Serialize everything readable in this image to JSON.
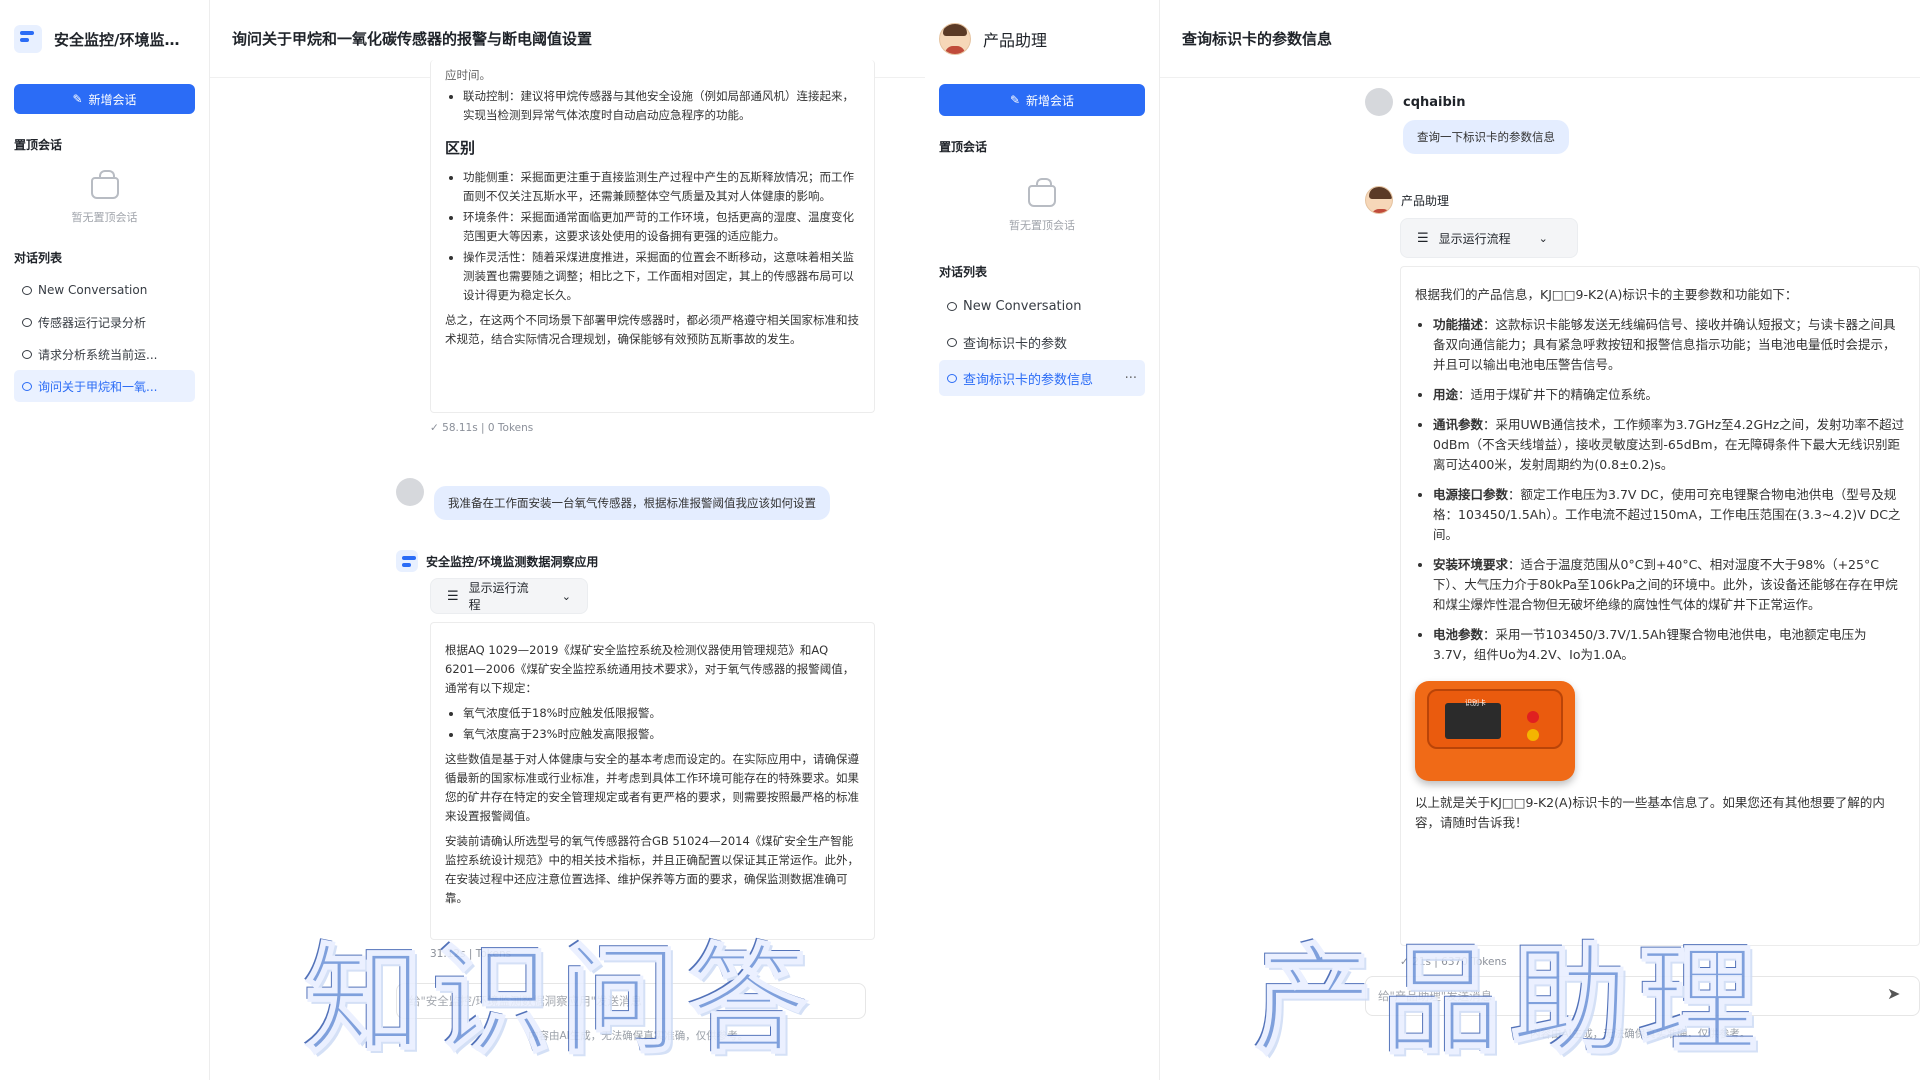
{
  "left_app": {
    "brand_title": "安全监控/环境监测...",
    "new_chat_label": "新增会话",
    "pinned_label": "置顶会话",
    "pinned_empty": "暂无置顶会话",
    "list_label": "对话列表",
    "conversations": [
      "New Conversation",
      "传感器运行记录分析",
      "请求分析系统当前运...",
      "询问关于甲烷和一氧..."
    ],
    "title": "询问关于甲烷和一氧化碳传感器的报警与断电阈值设置",
    "msg1_top_fragment": "应时间。",
    "msg1_link_item": "联动控制：建议将甲烷传感器与其他安全设施（例如局部通风机）连接起来，实现当检测到异常气体浓度时自动启动应急程序的功能。",
    "msg1_heading": "区别",
    "msg1_items": [
      "功能侧重：采掘面更注重于直接监测生产过程中产生的瓦斯释放情况；而工作面则不仅关注瓦斯水平，还需兼顾整体空气质量及其对人体健康的影响。",
      "环境条件：采掘面通常面临更加严苛的工作环境，包括更高的湿度、温度变化范围更大等因素，这要求该处使用的设备拥有更强的适应能力。",
      "操作灵活性：随着采煤进度推进，采掘面的位置会不断移动，这意味着相关监测装置也需要随之调整；相比之下，工作面相对固定，其上的传感器布局可以设计得更为稳定长久。"
    ],
    "msg1_summary": "总之，在这两个不同场景下部署甲烷传感器时，都必须严格遵守相关国家标准和技术规范，结合实际情况合理规划，确保能够有效预防瓦斯事故的发生。",
    "msg1_meta": "✓ 58.11s  |  0 Tokens",
    "user_msg": "我准备在工作面安装一台氧气传感器，根据标准报警阈值我应该如何设置",
    "bot_name": "安全监控/环境监测数据洞察应用",
    "flow_label": "显示运行流程",
    "msg2_intro": "根据AQ 1029—2019《煤矿安全监控系统及检测仪器使用管理规范》和AQ 6201—2006《煤矿安全监控系统通用技术要求》，对于氧气传感器的报警阈值，通常有以下规定：",
    "msg2_items": [
      "氧气浓度低于18%时应触发低限报警。",
      "氧气浓度高于23%时应触发高限报警。"
    ],
    "msg2_p1": "这些数值是基于对人体健康与安全的基本考虑而设定的。在实际应用中，请确保遵循最新的国家标准或行业标准，并考虑到具体工作环境可能存在的特殊要求。如果您的矿井存在特定的安全管理规定或者有更严格的要求，则需要按照最严格的标准来设置报警阈值。",
    "msg2_p2": "安装前请确认所选型号的氧气传感器符合GB 51024—2014《煤矿安全生产智能监控系统设计规范》中的相关技术指标，并且正确配置以保证其正常运作。此外，在安装过程中还应注意位置选择、维护保养等方面的要求，确保监测数据准确可靠。",
    "msg2_meta": "31.12s  |  Tokens",
    "input_placeholder": "给\"安全监控/环境监测数据洞察应用\"发送消息",
    "disclaimer": "内容由AI生成，无法确保真实准确，仅供参考。",
    "overlay": "知识问答"
  },
  "right_app": {
    "brand_title": "产品助理",
    "new_chat_label": "新增会话",
    "pinned_label": "置顶会话",
    "pinned_empty": "暂无置顶会话",
    "list_label": "对话列表",
    "conversations": [
      "New Conversation",
      "查询标识卡的参数",
      "查询标识卡的参数信息"
    ],
    "more_glyph": "···",
    "title": "查询标识卡的参数信息",
    "user_name": "cqhaibin",
    "user_msg": "查询一下标识卡的参数信息",
    "bot_name": "产品助理",
    "flow_label": "显示运行流程",
    "intro": "根据我们的产品信息，KJ□□9-K2(A)标识卡的主要参数和功能如下：",
    "items": [
      {
        "k": "功能描述",
        "v": "：这款标识卡能够发送无线编码信号、接收并确认短报文；与读卡器之间具备双向通信能力；具有紧急呼救按钮和报警信息指示功能；当电池电量低时会提示，并且可以输出电池电压警告信号。"
      },
      {
        "k": "用途",
        "v": "：适用于煤矿井下的精确定位系统。"
      },
      {
        "k": "通讯参数",
        "v": "：采用UWB通信技术，工作频率为3.7GHz至4.2GHz之间，发射功率不超过0dBm（不含天线增益），接收灵敏度达到-65dBm，在无障碍条件下最大无线识别距离可达400米，发射周期约为(0.8±0.2)s。"
      },
      {
        "k": "电源接口参数",
        "v": "：额定工作电压为3.7V DC，使用可充电锂聚合物电池供电（型号及规格：103450/1.5Ah）。工作电流不超过150mA，工作电压范围在(3.3~4.2)V DC之间。"
      },
      {
        "k": "安装环境要求",
        "v": "：适合于温度范围从0°C到+40°C、相对湿度不大于98%（+25°C下）、大气压力介于80kPa至106kPa之间的环境中。此外，该设备还能够在存在甲烷和煤尘爆炸性混合物但无破坏绝缘的腐蚀性气体的煤矿井下正常运作。"
      },
      {
        "k": "电池参数",
        "v": "：采用一节103450/3.7V/1.5Ah锂聚合物电池供电，电池额定电压为3.7V，组件Uo为4.2V、Io为1.0A。"
      }
    ],
    "product_tag": "识别卡",
    "outro": "以上就是关于KJ□□9-K2(A)标识卡的一些基本信息了。如果您还有其他想要了解的内容，请随时告诉我！",
    "meta": "✓ 21s  |  6370 Tokens",
    "input_placeholder": "给\"产品助理\"发送消息",
    "disclaimer": "内容由AI生成，无法确保真实准确，仅供参考。",
    "overlay": "产品助理"
  }
}
